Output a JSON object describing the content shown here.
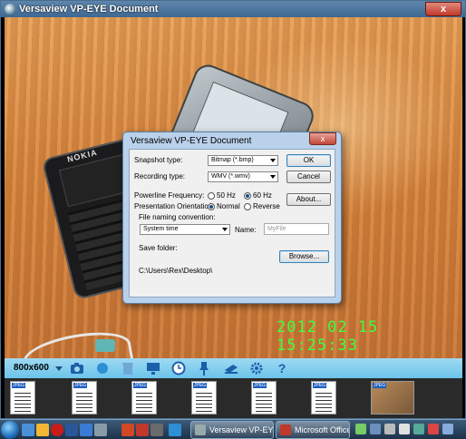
{
  "window": {
    "title": "Versaview VP-EYE Document",
    "close": "x"
  },
  "overlay": {
    "timestamp": "2012 02 15 15:25:33",
    "phone_brand": "NOKIA"
  },
  "dialog": {
    "title": "Versaview VP-EYE Document",
    "close": "x",
    "snapshot_label": "Snapshot type:",
    "snapshot_value": "Bitmap (*.bmp)",
    "recording_label": "Recording type:",
    "recording_value": "WMV (*.wmv)",
    "powerline_label": "Powerline Frequency:",
    "freq_50": "50 Hz",
    "freq_60": "60 Hz",
    "orientation_label": "Presentation Orientation:",
    "orient_normal": "Normal",
    "orient_reverse": "Reverse",
    "naming_label": "File naming convention:",
    "naming_value": "System time",
    "name_label": "Name:",
    "name_placeholder": "MyFile",
    "save_folder_label": "Save folder:",
    "save_folder_path": "C:\\Users\\Rex\\Desktop\\",
    "ok": "OK",
    "cancel": "Cancel",
    "about": "About...",
    "browse": "Browse..."
  },
  "toolbar": {
    "resolution": "800x600",
    "help": "?"
  },
  "thumbnails": {
    "tag": "JPEG"
  },
  "taskbar": {
    "task1": "Versaview VP-EYE...",
    "task2": "Microsoft Office..."
  }
}
